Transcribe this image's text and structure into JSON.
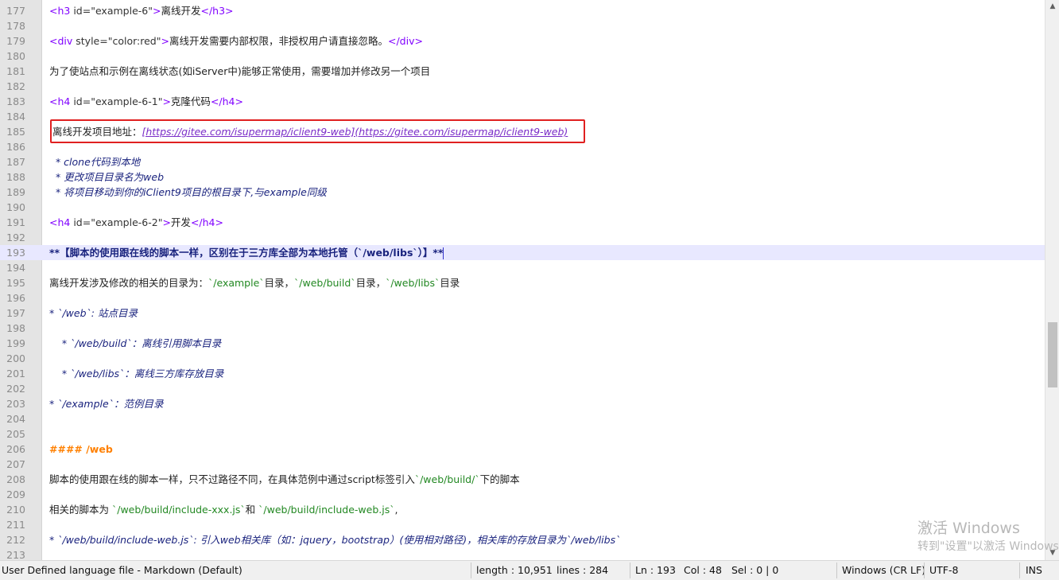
{
  "lines": [
    {
      "n": "177",
      "segs": [
        {
          "c": "tag",
          "t": "<h3 "
        },
        {
          "c": "str",
          "t": "id=\"example-6\""
        },
        {
          "c": "tag",
          "t": ">"
        },
        {
          "c": "plain",
          "t": "离线开发"
        },
        {
          "c": "tag",
          "t": "</h3>"
        }
      ]
    },
    {
      "n": "178",
      "segs": []
    },
    {
      "n": "179",
      "segs": [
        {
          "c": "tag",
          "t": "<div "
        },
        {
          "c": "str",
          "t": "style=\"color:red\""
        },
        {
          "c": "tag",
          "t": ">"
        },
        {
          "c": "plain",
          "t": "离线开发需要内部权限，非授权用户请直接忽略。"
        },
        {
          "c": "tag",
          "t": "</div>"
        }
      ]
    },
    {
      "n": "180",
      "segs": []
    },
    {
      "n": "181",
      "segs": [
        {
          "c": "plain",
          "t": "为了使站点和示例在离线状态(如iServer中)能够正常使用，需要增加并修改另一个项目"
        }
      ]
    },
    {
      "n": "182",
      "segs": []
    },
    {
      "n": "183",
      "segs": [
        {
          "c": "tag",
          "t": "<h4 "
        },
        {
          "c": "str",
          "t": "id=\"example-6-1\""
        },
        {
          "c": "tag",
          "t": ">"
        },
        {
          "c": "plain",
          "t": "克隆代码"
        },
        {
          "c": "tag",
          "t": "</h4>"
        }
      ]
    },
    {
      "n": "184",
      "segs": []
    },
    {
      "n": "185",
      "segs": [
        {
          "c": "plain",
          "t": " 离线开发项目地址："
        },
        {
          "c": "link",
          "t": "[https://gitee.com/isupermap/iclient9-web](https://gitee.com/isupermap/iclient9-web)"
        }
      ]
    },
    {
      "n": "186",
      "segs": []
    },
    {
      "n": "187",
      "segs": [
        {
          "c": "li",
          "t": "  * clone代码到本地"
        }
      ]
    },
    {
      "n": "188",
      "segs": [
        {
          "c": "li",
          "t": "  * 更改项目目录名为web"
        }
      ]
    },
    {
      "n": "189",
      "segs": [
        {
          "c": "li",
          "t": "  * 将项目移动到你的iClient9项目的根目录下,与example同级"
        }
      ]
    },
    {
      "n": "190",
      "segs": []
    },
    {
      "n": "191",
      "segs": [
        {
          "c": "tag",
          "t": "<h4 "
        },
        {
          "c": "str",
          "t": "id=\"example-6-2\""
        },
        {
          "c": "tag",
          "t": ">"
        },
        {
          "c": "plain",
          "t": "开发"
        },
        {
          "c": "tag",
          "t": "</h4>"
        }
      ]
    },
    {
      "n": "192",
      "segs": []
    },
    {
      "n": "193",
      "current": true,
      "segs": [
        {
          "c": "bold",
          "t": "**【脚本的使用跟在线的脚本一样，区别在于三方库全部为本地托管（`/web/libs`）】**"
        }
      ]
    },
    {
      "n": "194",
      "segs": []
    },
    {
      "n": "195",
      "segs": [
        {
          "c": "plain",
          "t": "离线开发涉及修改的相关的目录为："
        },
        {
          "c": "codev",
          "t": "`/example`"
        },
        {
          "c": "plain",
          "t": "目录，"
        },
        {
          "c": "codev",
          "t": "`/web/build`"
        },
        {
          "c": "plain",
          "t": "目录，"
        },
        {
          "c": "codev",
          "t": "`/web/libs`"
        },
        {
          "c": "plain",
          "t": "目录"
        }
      ]
    },
    {
      "n": "196",
      "segs": []
    },
    {
      "n": "197",
      "segs": [
        {
          "c": "li",
          "t": "* `/web`: 站点目录"
        }
      ]
    },
    {
      "n": "198",
      "segs": []
    },
    {
      "n": "199",
      "segs": [
        {
          "c": "li",
          "t": "    * `/web/build`：离线引用脚本目录"
        }
      ]
    },
    {
      "n": "200",
      "segs": []
    },
    {
      "n": "201",
      "segs": [
        {
          "c": "li",
          "t": "    * `/web/libs`：离线三方库存放目录"
        }
      ]
    },
    {
      "n": "202",
      "segs": []
    },
    {
      "n": "203",
      "segs": [
        {
          "c": "li",
          "t": "* `/example`：范例目录"
        }
      ]
    },
    {
      "n": "204",
      "segs": []
    },
    {
      "n": "205",
      "segs": []
    },
    {
      "n": "206",
      "segs": [
        {
          "c": "head",
          "t": "#### /web"
        }
      ]
    },
    {
      "n": "207",
      "segs": []
    },
    {
      "n": "208",
      "segs": [
        {
          "c": "plain",
          "t": "脚本的使用跟在线的脚本一样，只不过路径不同，在具体范例中通过script标签引入"
        },
        {
          "c": "codev",
          "t": "`/web/build/`"
        },
        {
          "c": "plain",
          "t": "下的脚本"
        }
      ]
    },
    {
      "n": "209",
      "segs": []
    },
    {
      "n": "210",
      "segs": [
        {
          "c": "plain",
          "t": "相关的脚本为 "
        },
        {
          "c": "codev",
          "t": "`/web/build/include-xxx.js`"
        },
        {
          "c": "plain",
          "t": "和 "
        },
        {
          "c": "codev",
          "t": "`/web/build/include-web.js`"
        },
        {
          "c": "plain",
          "t": ","
        }
      ]
    },
    {
      "n": "211",
      "segs": []
    },
    {
      "n": "212",
      "segs": [
        {
          "c": "li",
          "t": "* `/web/build/include-web.js`: 引入web相关库（如：jquery，bootstrap）(使用相对路径)，相关库的存放目录为`/web/libs`"
        }
      ]
    },
    {
      "n": "213",
      "segs": []
    }
  ],
  "status": {
    "language": "User Defined language file - Markdown (Default)",
    "length": "length : 10,951",
    "lines": "lines : 284",
    "ln": "Ln : 193",
    "col": "Col : 48",
    "sel": "Sel : 0 | 0",
    "eol": "Windows (CR LF)",
    "encoding": "UTF-8",
    "mode": "INS"
  },
  "watermark": {
    "line1": "激活 Windows",
    "line2": "转到\"设置\"以激活 Windows"
  },
  "scrollbar": {
    "position": 0.66
  },
  "colors": {
    "tag": "#8000ff",
    "link": "#7a2cc8",
    "list": "#1a237e",
    "code": "#228822",
    "heading": "#ff8000",
    "highlight_box": "#e02020",
    "current_line": "#e8e8ff"
  }
}
